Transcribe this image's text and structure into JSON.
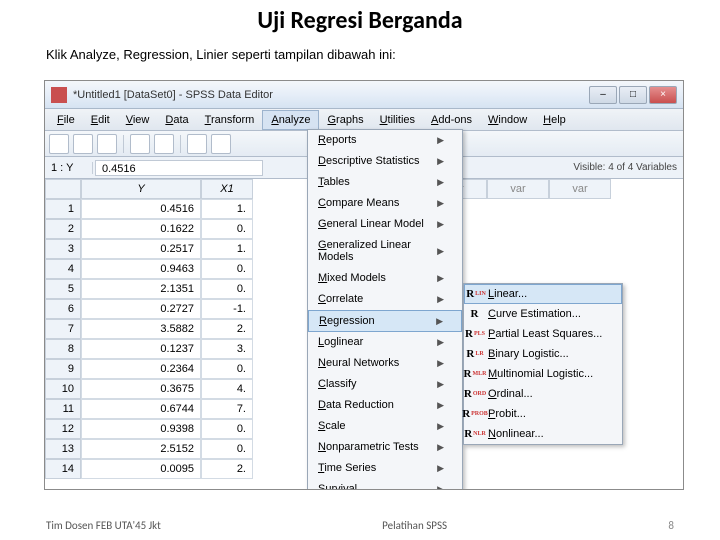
{
  "slide": {
    "title": "Uji Regresi Berganda",
    "subtitle": "Klik Analyze, Regression, Linier seperti tampilan dibawah ini:",
    "footer_left": "Tim Dosen FEB UTA'45 Jkt",
    "footer_center": "Pelatihan SPSS",
    "footer_right": "8"
  },
  "window": {
    "title": "*Untitled1 [DataSet0] - SPSS Data Editor",
    "min_label": "–",
    "max_label": "□",
    "close_label": "×"
  },
  "menubar": [
    "File",
    "Edit",
    "View",
    "Data",
    "Transform",
    "Analyze",
    "Graphs",
    "Utilities",
    "Add-ons",
    "Window",
    "Help"
  ],
  "cell_editor": {
    "ref": "1 : Y",
    "value": "0.4516"
  },
  "visible_label": "Visible: 4 of 4 Variables",
  "columns": [
    "",
    "Y",
    "X1"
  ],
  "var_headers": [
    "var",
    "var",
    "var"
  ],
  "rows": [
    {
      "n": "1",
      "y": "0.4516",
      "x1": "1."
    },
    {
      "n": "2",
      "y": "0.1622",
      "x1": "0."
    },
    {
      "n": "3",
      "y": "0.2517",
      "x1": "1."
    },
    {
      "n": "4",
      "y": "0.9463",
      "x1": "0."
    },
    {
      "n": "5",
      "y": "2.1351",
      "x1": "0."
    },
    {
      "n": "6",
      "y": "0.2727",
      "x1": "-1."
    },
    {
      "n": "7",
      "y": "3.5882",
      "x1": "2."
    },
    {
      "n": "8",
      "y": "0.1237",
      "x1": "3."
    },
    {
      "n": "9",
      "y": "0.2364",
      "x1": "0."
    },
    {
      "n": "10",
      "y": "0.3675",
      "x1": "4."
    },
    {
      "n": "11",
      "y": "0.6744",
      "x1": "7."
    },
    {
      "n": "12",
      "y": "0.9398",
      "x1": "0."
    },
    {
      "n": "13",
      "y": "2.5152",
      "x1": "0."
    },
    {
      "n": "14",
      "y": "0.0095",
      "x1": "2."
    }
  ],
  "analyze_menu": [
    "Reports",
    "Descriptive Statistics",
    "Tables",
    "Compare Means",
    "General Linear Model",
    "Generalized Linear Models",
    "Mixed Models",
    "Correlate",
    "Regression",
    "Loglinear",
    "Neural Networks",
    "Classify",
    "Data Reduction",
    "Scale",
    "Nonparametric Tests",
    "Time Series",
    "Survival"
  ],
  "regression_submenu": [
    {
      "icon_sub": "LIN",
      "label": "Linear..."
    },
    {
      "icon_sub": "",
      "label": "Curve Estimation..."
    },
    {
      "icon_sub": "PLS",
      "label": "Partial Least Squares..."
    },
    {
      "icon_sub": "LR",
      "label": "Binary Logistic..."
    },
    {
      "icon_sub": "MLR",
      "label": "Multinomial Logistic..."
    },
    {
      "icon_sub": "ORD",
      "label": "Ordinal..."
    },
    {
      "icon_sub": "PROB",
      "label": "Probit..."
    },
    {
      "icon_sub": "NLR",
      "label": "Nonlinear..."
    }
  ]
}
